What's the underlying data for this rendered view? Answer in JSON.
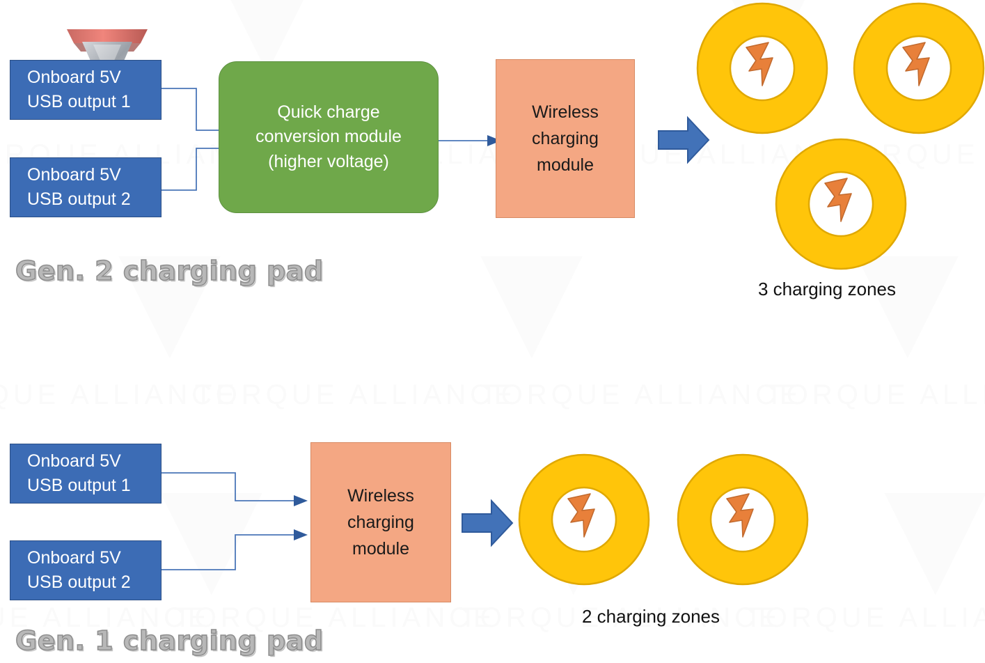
{
  "diagram": {
    "title_hidden": "",
    "watermark": {
      "brand_text": "TORQUE ALLIANCE",
      "logo_name": "torque-alliance-logo"
    },
    "colors": {
      "usb_box_fill": "#3C6CB5",
      "usb_box_border": "#2A4E86",
      "green_box_fill": "#6FA84A",
      "green_box_border": "#5D9140",
      "salmon_box_fill": "#F4A783",
      "salmon_box_border": "#D78A63",
      "zone_ring_fill": "#FFC50A",
      "zone_ring_border": "#E0A800",
      "bolt_fill": "#E8803A",
      "bolt_border": "#C26A2E",
      "arrow_fill": "#4272B8",
      "arrow_border": "#2F5A9B",
      "connector_line": "#4A76B8",
      "gen_label_color": "#b8b8b8"
    },
    "gen2": {
      "label": "Gen. 2 charging pad",
      "inputs": [
        {
          "line1": "Onboard 5V",
          "line2": "USB output 1"
        },
        {
          "line1": "Onboard 5V",
          "line2": "USB output 2"
        }
      ],
      "converter": {
        "line1": "Quick charge",
        "line2": "conversion module",
        "line3": "(higher voltage)"
      },
      "wireless": {
        "line1": "Wireless",
        "line2": "charging",
        "line3": "module"
      },
      "zones_caption": "3 charging zones",
      "zone_count": 3
    },
    "gen1": {
      "label": "Gen. 1 charging pad",
      "inputs": [
        {
          "line1": "Onboard 5V",
          "line2": "USB output 1"
        },
        {
          "line1": "Onboard 5V",
          "line2": "USB output 2"
        }
      ],
      "wireless": {
        "line1": "Wireless",
        "line2": "charging",
        "line3": "module"
      },
      "zones_caption": "2 charging zones",
      "zone_count": 2
    }
  }
}
